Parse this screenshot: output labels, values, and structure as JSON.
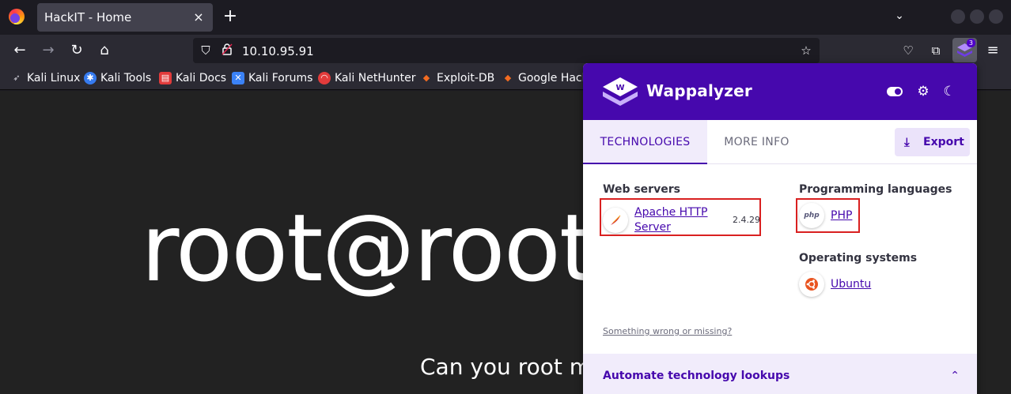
{
  "browser": {
    "tab_title": "HackIT - Home",
    "tab_close_icon": "×",
    "new_tab_icon": "+",
    "url": "10.10.95.91"
  },
  "bookmarks": [
    {
      "label": "Kali Linux",
      "icon": "kali-dragon-icon",
      "color": "#cfcfd8"
    },
    {
      "label": "Kali Tools",
      "icon": "kali-tools-icon",
      "color": "#367bf0"
    },
    {
      "label": "Kali Docs",
      "icon": "kali-docs-icon",
      "color": "#e23b3b"
    },
    {
      "label": "Kali Forums",
      "icon": "kali-forums-icon",
      "color": "#3b82f6"
    },
    {
      "label": "Kali NetHunter",
      "icon": "nethunter-icon",
      "color": "#e23b3b"
    },
    {
      "label": "Exploit-DB",
      "icon": "exploitdb-icon",
      "color": "#f26b21"
    },
    {
      "label": "Google Hack",
      "icon": "ghdb-icon",
      "color": "#f26b21"
    }
  ],
  "page": {
    "hero": "root@root",
    "subtitle": "Can you root me"
  },
  "wappalyzer": {
    "name": "Wappalyzer",
    "badge": "3",
    "tabs": {
      "technologies": "TECHNOLOGIES",
      "more_info": "MORE INFO"
    },
    "export_label": "Export",
    "categories": {
      "web_servers": {
        "title": "Web servers",
        "tech": {
          "name": "Apache HTTP Server",
          "version": "2.4.29",
          "icon": "apache-feather-icon"
        }
      },
      "programming_languages": {
        "title": "Programming languages",
        "tech": {
          "name": "PHP",
          "icon": "php-icon"
        }
      },
      "operating_systems": {
        "title": "Operating systems",
        "tech": {
          "name": "Ubuntu",
          "icon": "ubuntu-icon"
        }
      }
    },
    "feedback_link": "Something wrong or missing?",
    "automate_label": "Automate technology lookups"
  },
  "colors": {
    "wappalyzer_purple": "#4608ad",
    "highlight_red": "#d92020"
  }
}
